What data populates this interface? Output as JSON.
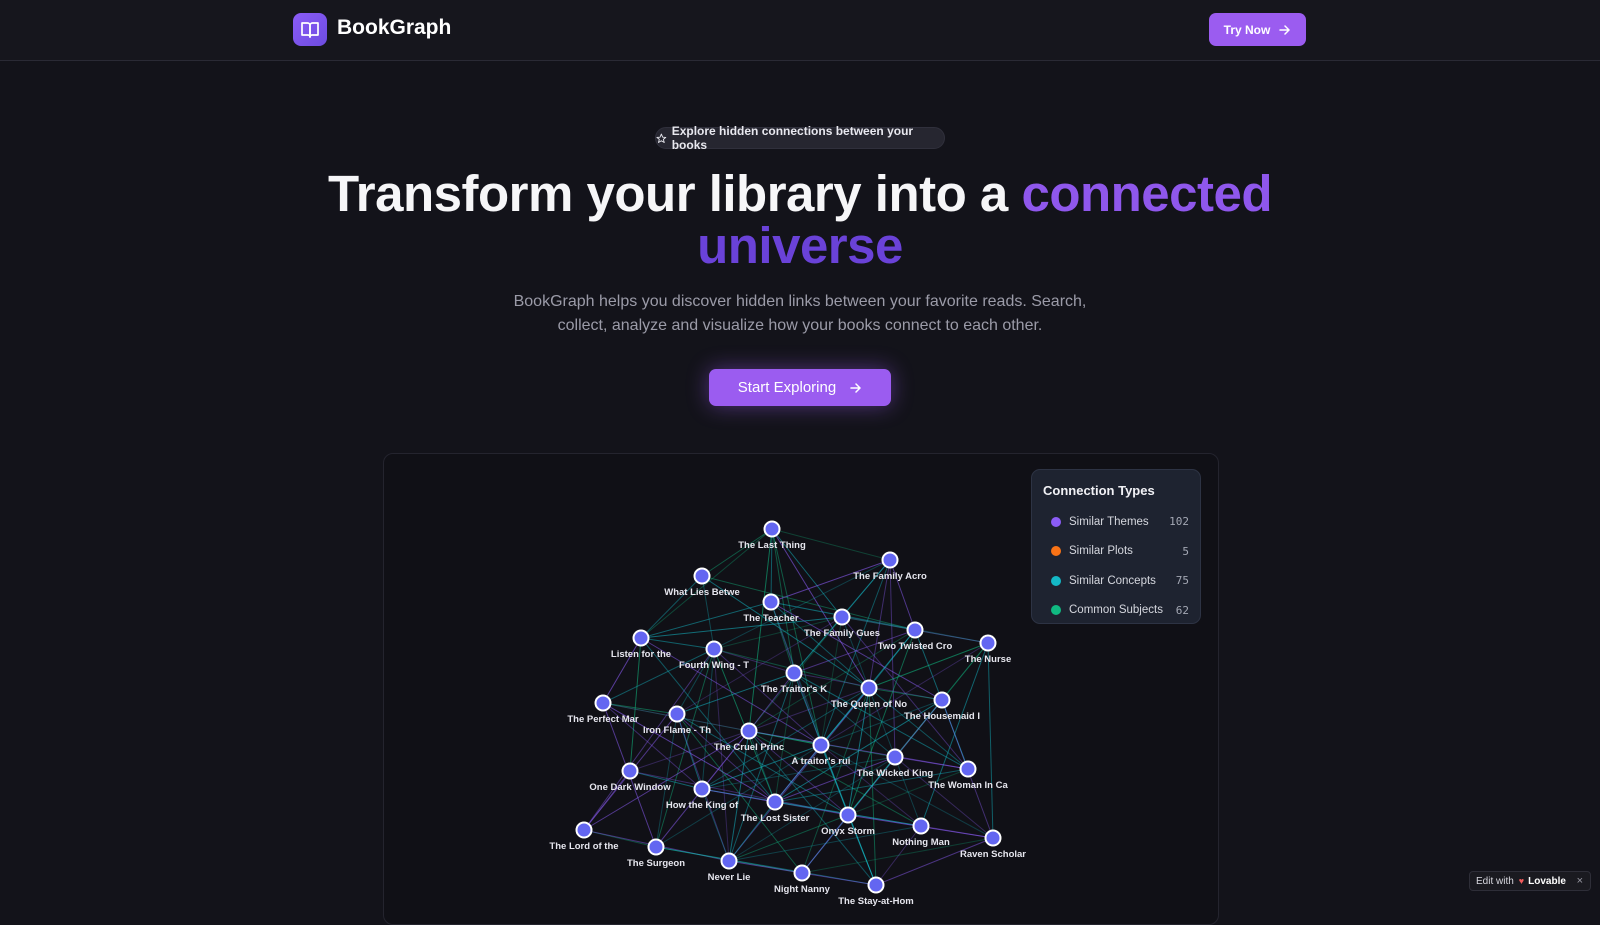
{
  "header": {
    "brand": "BookGraph",
    "try_label": "Try Now"
  },
  "hero": {
    "pill_text": "Explore hidden connections between your books",
    "headline_plain": "Transform your library into a ",
    "headline_accent_1": "connected",
    "headline_accent_2": "universe",
    "subtitle_line_1": "BookGraph helps you discover hidden links between your favorite reads. Search,",
    "subtitle_line_2": "collect, analyze and visualize how your books connect to each other.",
    "cta_label": "Start Exploring"
  },
  "legend": {
    "title": "Connection Types",
    "items": [
      {
        "label": "Similar Themes",
        "count": "102",
        "color": "#8b5cf6"
      },
      {
        "label": "Similar Plots",
        "count": "5",
        "color": "#f97316"
      },
      {
        "label": "Similar Concepts",
        "count": "75",
        "color": "#14b8c6"
      },
      {
        "label": "Common Subjects",
        "count": "62",
        "color": "#10b981"
      }
    ]
  },
  "graph": {
    "node_color": "#6366f1",
    "books": [
      "The Last Thing",
      "The Family Acro",
      "What Lies Betwe",
      "The Teacher",
      "The Family Gues",
      "Two Twisted Cro",
      "Listen for the",
      "Fourth Wing - T",
      "The Nurse",
      "The Traitor's K",
      "The Queen of No",
      "The Perfect Mar",
      "Iron Flame - Th",
      "The Housemaid I",
      "The Cruel Princ",
      "A traitor's rui",
      "The Wicked King",
      "The Woman In Ca",
      "One Dark Window",
      "How the King of",
      "The Lost Sister",
      "Onyx Storm",
      "Nothing Man",
      "The Lord of the",
      "The Surgeon",
      "Raven Scholar",
      "Never Lie",
      "Night Nanny",
      "The Stay-at-Hom"
    ]
  },
  "badge": {
    "edit_with": "Edit with",
    "lovable": "Lovable",
    "close": "×"
  }
}
